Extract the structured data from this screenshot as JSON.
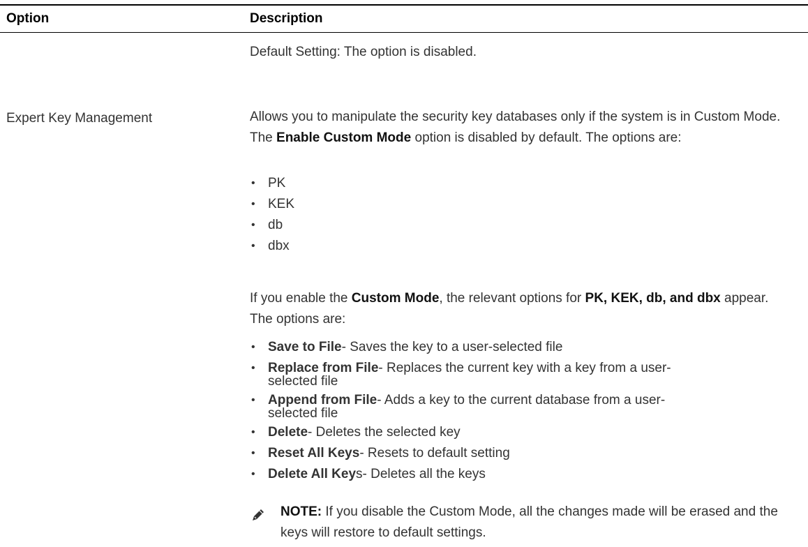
{
  "table": {
    "header_option": "Option",
    "header_description": "Description"
  },
  "row": {
    "default_setting": "Default Setting: The option is disabled.",
    "option_name": "Expert Key Management",
    "para1_prefix": "Allows you to manipulate the security key databases only if the system is in Custom Mode. The ",
    "para1_bold": "Enable Custom Mode",
    "para1_suffix": " option is disabled by default. The options are:",
    "simple_options": [
      "PK",
      "KEK",
      "db",
      "dbx"
    ],
    "para2_a": "If you enable the ",
    "para2_b": "Custom Mode",
    "para2_c": ", the relevant options for ",
    "para2_d": "PK, KEK, db, and dbx",
    "para2_e": " appear. The options are:",
    "actions": [
      {
        "bold": "Save to File",
        "text": "- Saves the key to a user-selected file",
        "text2": ""
      },
      {
        "bold": "Replace from File",
        "text": "- Replaces the current key with a key from a user-",
        "text2": "selected file"
      },
      {
        "bold": "Append from File",
        "text": "- Adds a key to the current database from a user-",
        "text2": "selected file"
      },
      {
        "bold": "Delete",
        "text": "- Deletes the selected key",
        "text2": ""
      },
      {
        "bold": "Reset All Keys",
        "text": "- Resets to default setting",
        "text2": ""
      },
      {
        "bold": "Delete All Key",
        "text": "s- Deletes all the keys",
        "text2": ""
      }
    ],
    "bullet": "•",
    "note_label": "NOTE:",
    "note_text": " If you disable the Custom Mode, all the changes made will be erased and the keys will restore to default settings.",
    "note_icon": "pencil-icon"
  }
}
